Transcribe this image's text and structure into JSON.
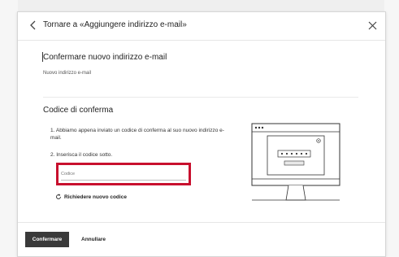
{
  "header": {
    "title": "Tornare a «Aggiungere indirizzo e-mail»"
  },
  "new_email": {
    "title": "Confermare nuovo indirizzo e-mail",
    "field_label": "Nuovo indirizzo e-mail"
  },
  "code_section": {
    "title": "Codice di conferma",
    "step1": "1.  Abbiamo appena inviato un codice di conferma al suo nuovo indirizzo e-mail.",
    "step2": "2.  Inserisca il codice sotto.",
    "code_placeholder": "Codice",
    "resend_label": "Richiedere nuovo codice"
  },
  "footer": {
    "confirm_label": "Confermare",
    "cancel_label": "Annullare"
  },
  "colors": {
    "highlight": "#c8102e",
    "primary_button": "#3a3a3a"
  }
}
